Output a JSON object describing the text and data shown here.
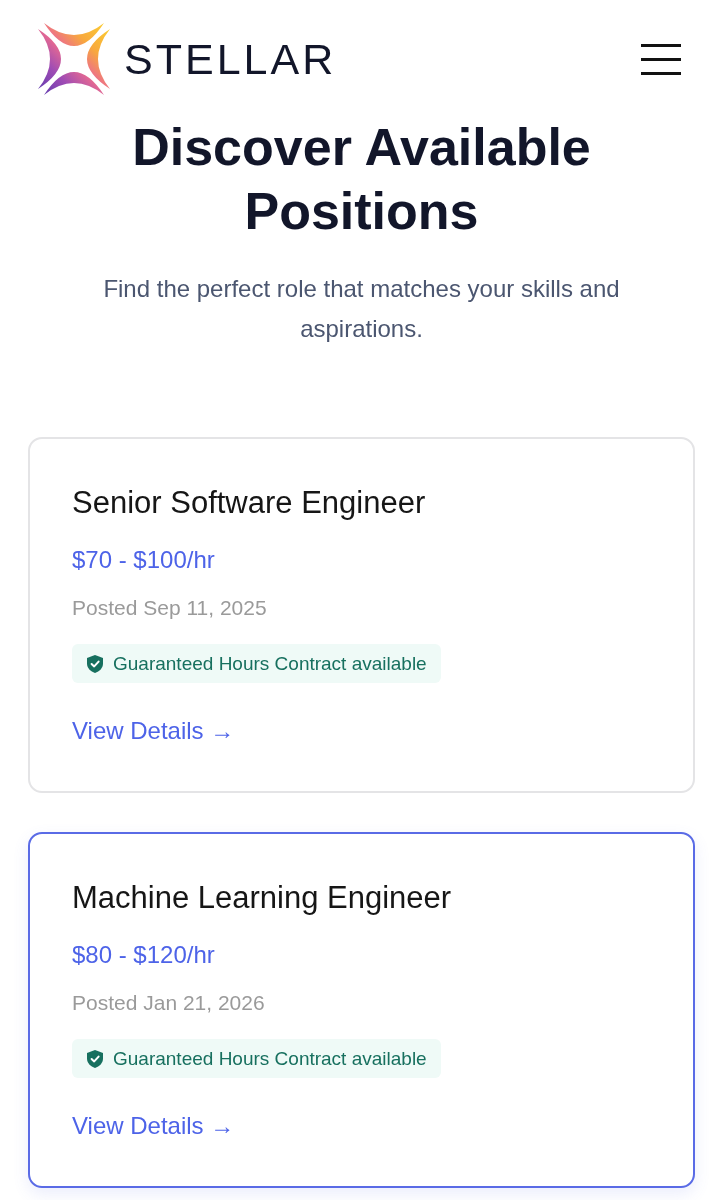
{
  "header": {
    "logo_text": "STELLAR"
  },
  "hero": {
    "title": "Discover Available Positions",
    "subtitle": "Find the perfect role that matches your skills and aspirations."
  },
  "jobs": [
    {
      "title": "Senior Software Engineer",
      "pay": "$70 - $100/hr",
      "posted": "Posted Sep 11, 2025",
      "badge": "Guaranteed Hours Contract available",
      "link": "View Details →",
      "selected": false
    },
    {
      "title": "Machine Learning Engineer",
      "pay": "$80 - $120/hr",
      "posted": "Posted Jan 21, 2026",
      "badge": "Guaranteed Hours Contract available",
      "link": "View Details →",
      "selected": true
    }
  ]
}
